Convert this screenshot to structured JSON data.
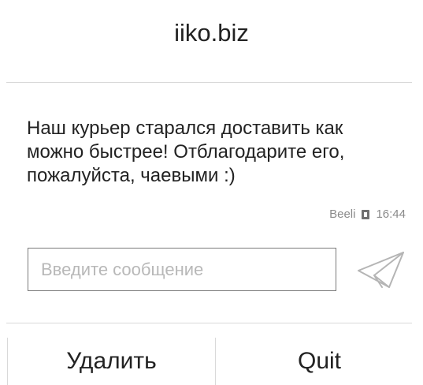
{
  "header": {
    "title": "iiko.biz"
  },
  "message": {
    "text": "Наш курьер старался доставить как можно быстрее! Отблагодарите его, пожалуйста, чаевыми :)",
    "sender": "Beeli",
    "time": "16:44",
    "status_icon": "sim-card-icon"
  },
  "composer": {
    "placeholder": "Введите сообщение",
    "value": "",
    "send_icon": "paper-plane-icon"
  },
  "actions": {
    "delete_label": "Удалить",
    "quit_label": "Quit"
  }
}
